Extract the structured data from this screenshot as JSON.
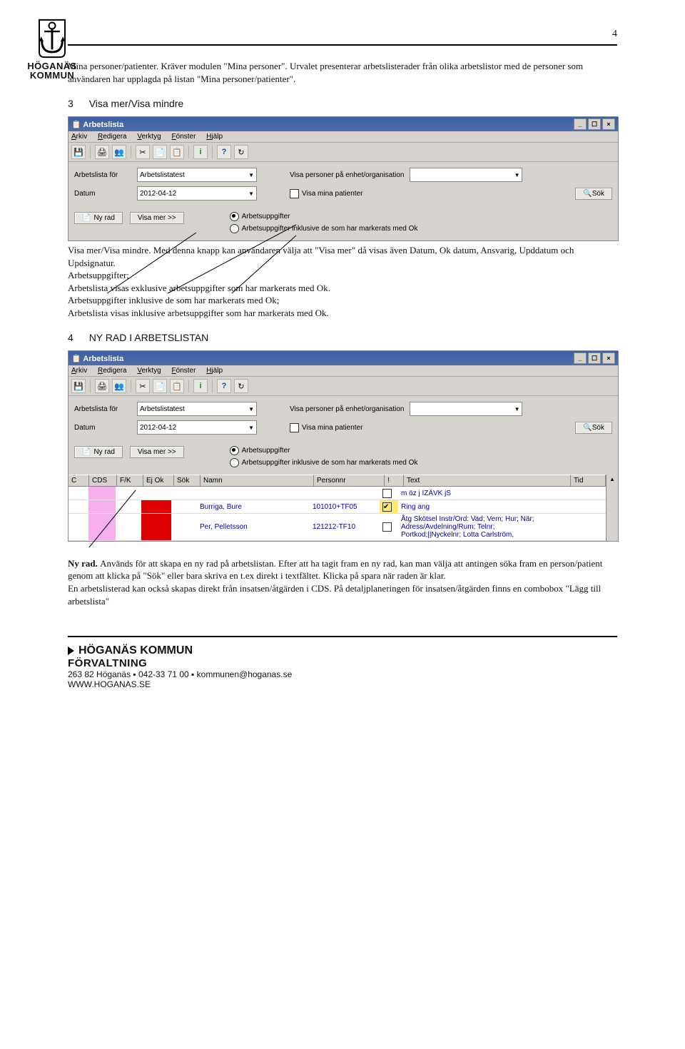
{
  "page_number": "4",
  "logo": {
    "line1": "HÖGANÄS",
    "line2": "KOMMUN"
  },
  "intro": {
    "text": "Mina personer/patienter. Kräver modulen \"Mina personer\". Urvalet presenterar arbetslisterader från olika arbetslistor med de personer som användaren har upplagda på listan \"Mina personer/patienter\"."
  },
  "section3": {
    "number": "3",
    "title": "Visa mer/Visa mindre"
  },
  "screenshot": {
    "title": "Arbetslista",
    "menus": {
      "arkiv": "Arkiv",
      "redigera": "Redigera",
      "verktyg": "Verktyg",
      "fonster": "Fönster",
      "hjalp": "Hjälp"
    },
    "labels": {
      "arbetslista_for": "Arbetslista för",
      "arbetslistatest": "Arbetslistatest",
      "visa_personer_pa": "Visa personer på enhet/organisation",
      "datum": "Datum",
      "datum_val": "2012-04-12",
      "visa_mina_patienter": "Visa mina patienter",
      "sok": "Sök",
      "ny_rad": "Ny rad",
      "visa_mer": "Visa mer >>",
      "radio1": "Arbetsuppgifter",
      "radio2": "Arbetsuppgifter inklusive de som har markerats med Ok"
    },
    "table": {
      "headers": [
        "C",
        "CDS",
        "F/K",
        "Ej Ok",
        "Sök",
        "Namn",
        "Personnr",
        "!",
        "Text",
        "Tid"
      ],
      "rows": [
        {
          "namn": "",
          "personnr": "",
          "flag": "",
          "text": "m öz j IZÄVK jS"
        },
        {
          "namn": "Burriga, Bure",
          "personnr": "101010+TF05",
          "flag": "✓",
          "text": "Ring ang"
        },
        {
          "namn": "Per, Pelletsson",
          "personnr": "121212-TF10",
          "flag": "",
          "text": "Åtg Skötsel Instr/Ord: Vad;  Vem; Hur; När;\nAdress/Avdelning/Rum;  Telnr;\nPortkod;||Nyckelnr;  Lotta Carlström,"
        }
      ]
    }
  },
  "after_s3_text": "Visa mer/Visa mindre. Med denna knapp kan användaren välja att \"Visa mer\" då visas även Datum, Ok datum, Ansvarig, Upddatum och Updsignatur.\nArbetsuppgifter;\nArbetslista visas exklusive arbetsuppgifter som har markerats med Ok.\nArbetsuppgifter inklusive de som har markerats med Ok;\nArbetslista visas inklusive arbetsuppgifter som har markerats med Ok.",
  "section4": {
    "number": "4",
    "title": "NY RAD I ARBETSLISTAN"
  },
  "after_s4_bold": "Ny rad. ",
  "after_s4_text": "Används för att skapa en ny rad på arbetslistan. Efter att ha tagit fram en ny rad, kan man välja att antingen söka fram en person/patient genom att klicka på \"Sök\" eller bara skriva en t.ex direkt i textfältet. Klicka på spara när raden är klar.\nEn arbetslisterad kan också skapas direkt från insatsen/åtgärden i CDS. På detaljplaneringen för insatsen/åtgärden finns en combobox \"Lägg till arbetslista\"",
  "footer": {
    "line1a": "HÖGANÄS KOMMUN",
    "line2": "FÖRVALTNING",
    "line3": "263 82 Höganäs ▪ 042-33 71 00 ▪ kommunen@hoganas.se",
    "line4": "WWW.HOGANAS.SE"
  }
}
